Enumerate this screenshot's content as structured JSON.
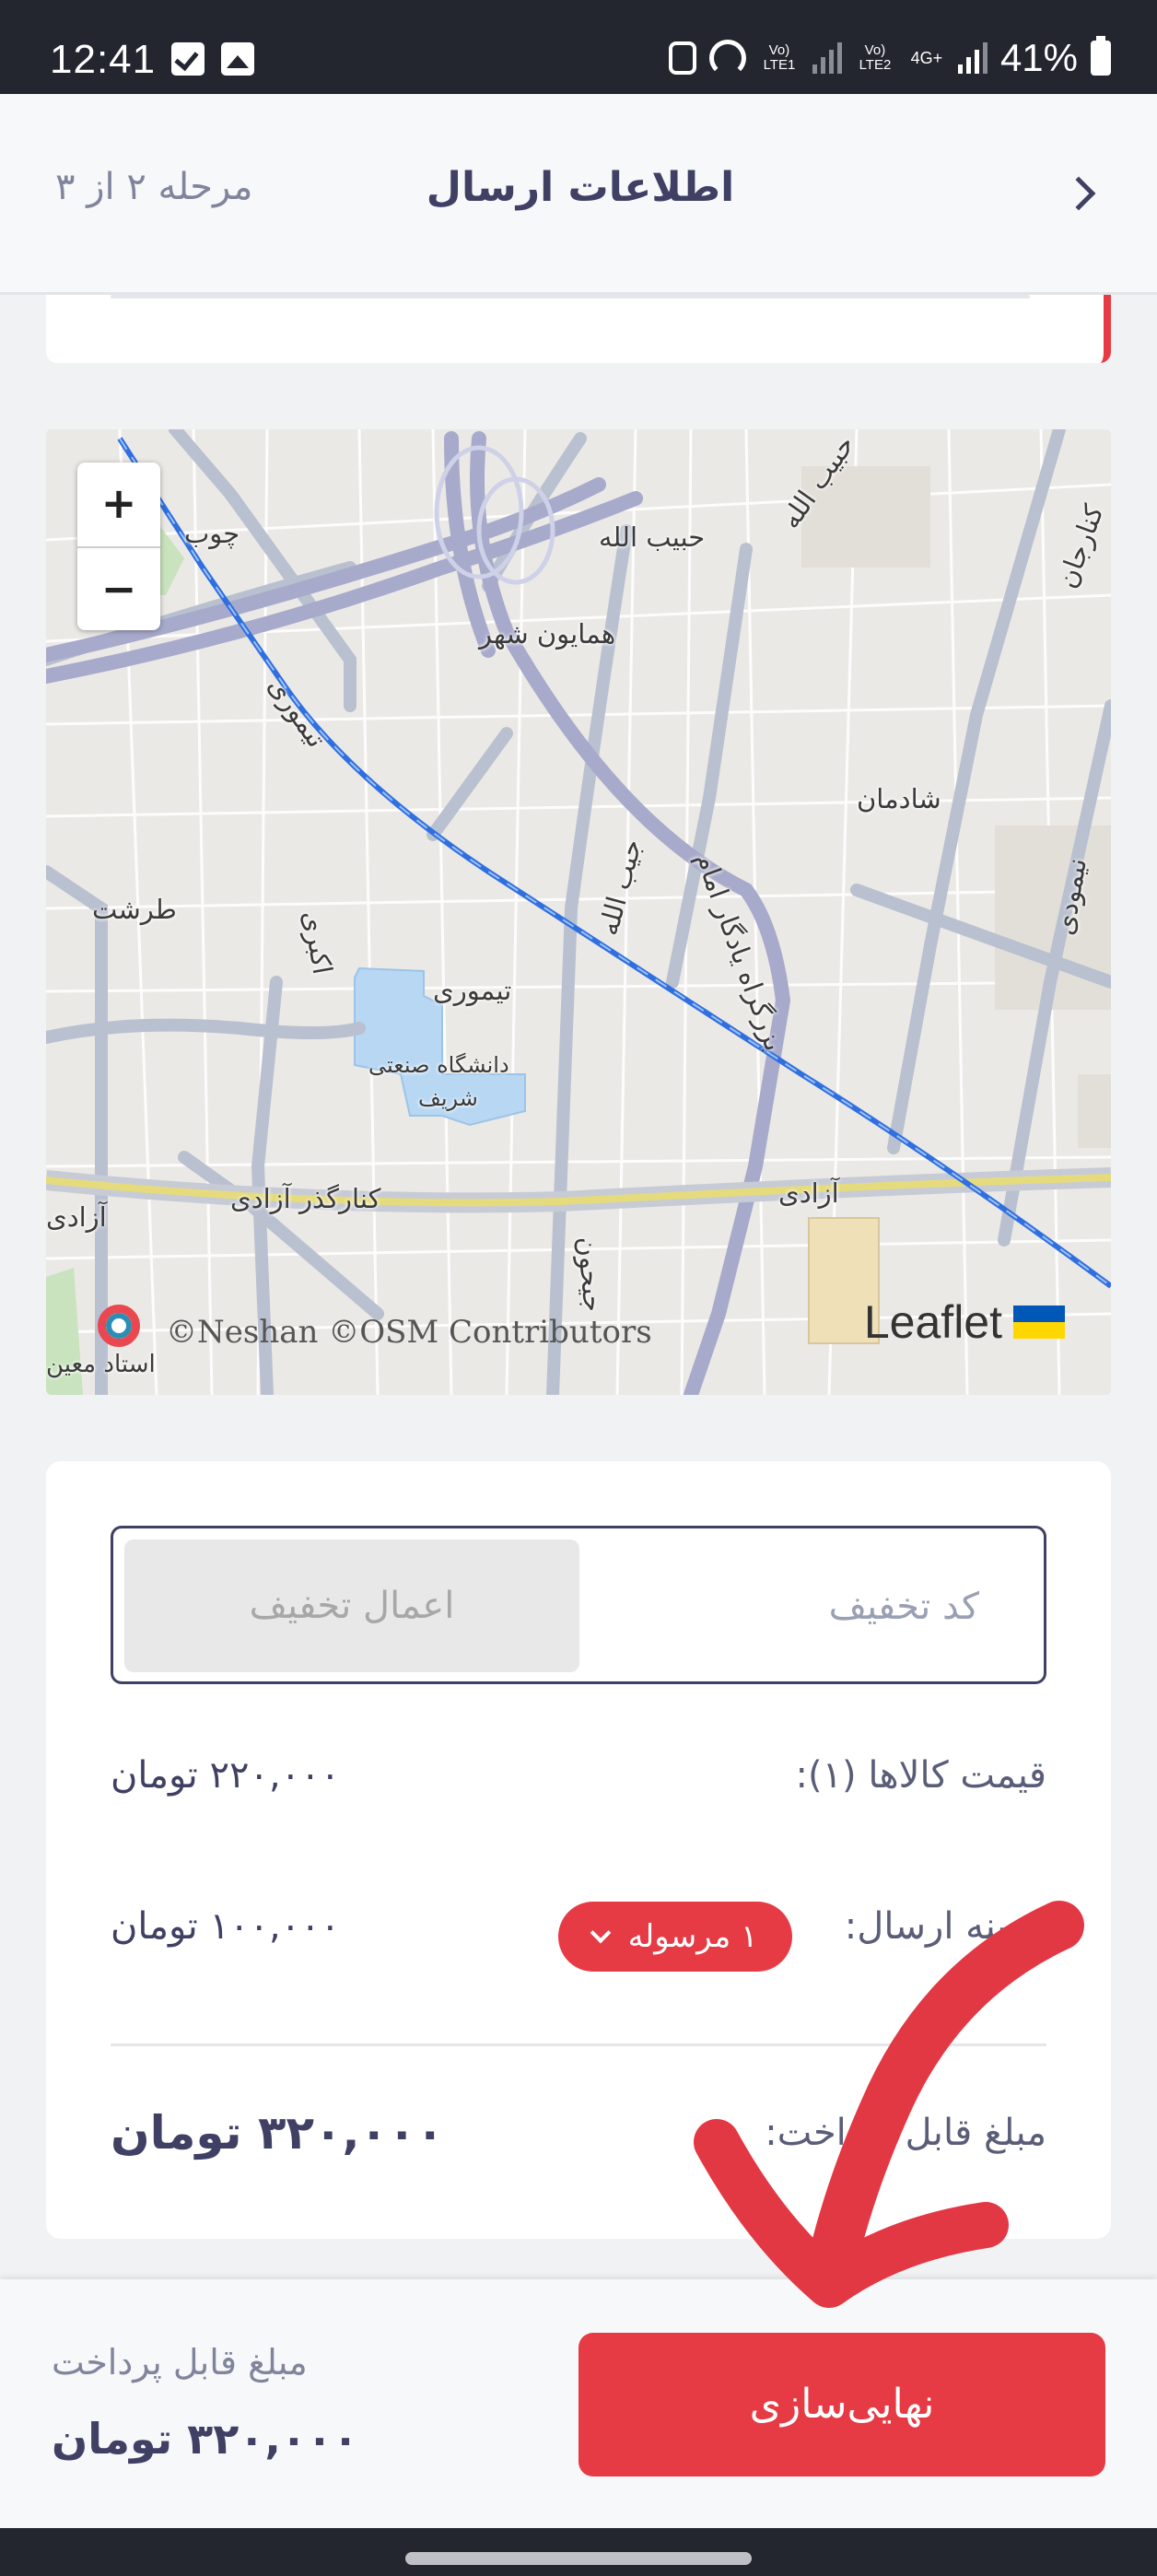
{
  "status_bar": {
    "time": "12:41",
    "lte1": "Vo) LTE1",
    "lte2": "Vo) LTE2",
    "net": "4G+",
    "battery": "41%"
  },
  "header": {
    "title": "اطلاعات ارسال",
    "step": "مرحله ۲ از ۳"
  },
  "map": {
    "zoom_in": "+",
    "zoom_out": "−",
    "attribution": "©Neshan ©OSM Contributors",
    "leaflet": "Leaflet",
    "labels": {
      "l1": "حبیب الله",
      "l2": "حبیب الله",
      "l3": "همایون شهر",
      "l4": "شادمان",
      "l5": "نیمودی",
      "l6": "کنارجان",
      "l7": "تیموری",
      "l8": "طرشت",
      "l9": "اکبری",
      "l10": "تیموری",
      "l11": "دانشگاه صنعتی",
      "l12": "شریف",
      "l13": "بزرگراه یادگار امام",
      "l14": "جیب الله",
      "l15": "آزادی",
      "l16": "کنارگذر آزادی",
      "l17": "آزادی",
      "l18": "استاد معین",
      "l19": "چوب",
      "l20": "جیحون"
    }
  },
  "summary": {
    "discount_placeholder": "کد تخفیف",
    "apply_label": "اعمال تخفیف",
    "items_label": "قیمت کالاها (۱):",
    "items_value": "۲۲۰,۰۰۰ تومان",
    "shipping_label": "هزینه ارسال:",
    "shipping_option": "۱ مرسوله",
    "shipping_value": "۱۰۰,۰۰۰ تومان",
    "total_label": "مبلغ قابل پرداخت:",
    "total_value": "۳۲۰,۰۰۰ تومان"
  },
  "bottom_bar": {
    "payable_label": "مبلغ قابل پرداخت",
    "payable_value": "۳۲۰,۰۰۰ تومان",
    "finalize_label": "نهایی‌سازی"
  },
  "colors": {
    "accent": "#e63b44",
    "text": "#3f4064",
    "annotation_arrow": "#e23844"
  },
  "icons": {
    "back": "chevron-right-icon",
    "dropdown": "chevron-down-icon",
    "flag": "ukraine-flag-icon",
    "logo": "neshan-logo-icon"
  }
}
